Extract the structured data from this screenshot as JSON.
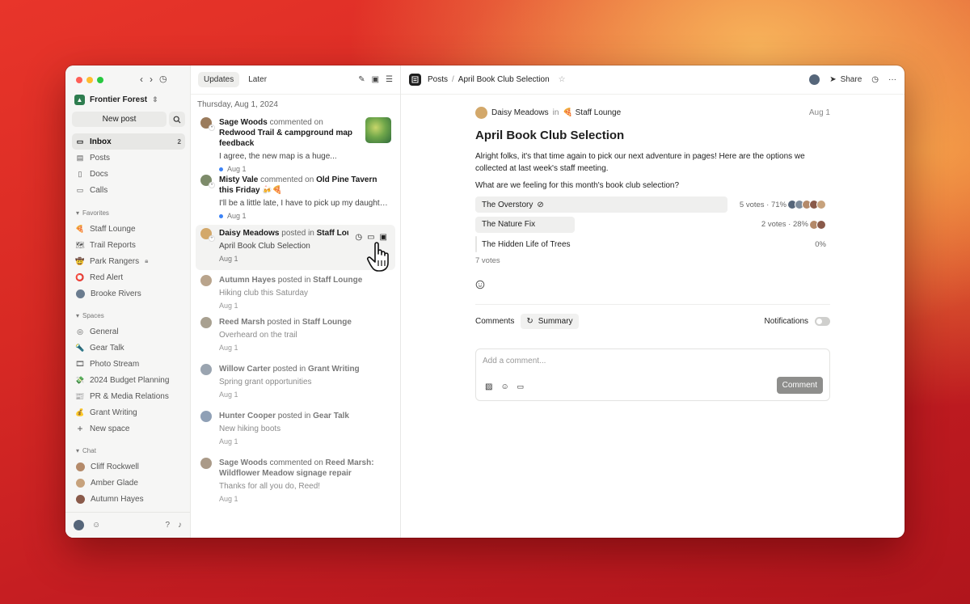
{
  "colors": {
    "red": "#ff5f57",
    "yellow": "#febc2e",
    "green": "#28c840",
    "accent_blue": "#3b82f6"
  },
  "workspace": {
    "name": "Frontier Forest"
  },
  "sidebar": {
    "new_post": "New post",
    "nav": [
      {
        "label": "Inbox",
        "count": "2",
        "icon": "inbox-icon"
      },
      {
        "label": "Posts",
        "icon": "posts-icon"
      },
      {
        "label": "Docs",
        "icon": "docs-icon"
      },
      {
        "label": "Calls",
        "icon": "video-icon"
      }
    ],
    "favorites_title": "Favorites",
    "favorites": [
      {
        "label": "Staff Lounge",
        "emoji": "🍕"
      },
      {
        "label": "Trail Reports",
        "emoji": "🗺"
      },
      {
        "label": "Park Rangers",
        "emoji": "🤠"
      },
      {
        "label": "Red Alert",
        "emoji": "⭕"
      },
      {
        "label": "Brooke Rivers",
        "emoji": ""
      }
    ],
    "spaces_title": "Spaces",
    "spaces": [
      {
        "label": "General",
        "emoji": "◎"
      },
      {
        "label": "Gear Talk",
        "emoji": "🔦"
      },
      {
        "label": "Photo Stream",
        "emoji": "🎞"
      },
      {
        "label": "2024 Budget Planning",
        "emoji": "💸"
      },
      {
        "label": "PR & Media Relations",
        "emoji": "📰"
      },
      {
        "label": "Grant Writing",
        "emoji": "💰"
      },
      {
        "label": "New space",
        "emoji": "+"
      }
    ],
    "chat_title": "Chat",
    "chats": [
      {
        "label": "Cliff Rockwell"
      },
      {
        "label": "Amber Glade"
      },
      {
        "label": "Autumn Hayes"
      }
    ]
  },
  "middle": {
    "tabs": [
      "Updates",
      "Later"
    ],
    "date_header": "Thursday, Aug 1, 2024",
    "items": [
      {
        "author": "Sage Woods",
        "verb": "commented on",
        "target": "Redwood Trail & campground map feedback",
        "snippet": "I agree, the new map is a huge...",
        "date": "Aug 1",
        "unread": true
      },
      {
        "author": "Misty Vale",
        "verb": "commented on",
        "target": "Old Pine Tavern this Friday 🍻🍕",
        "snippet": "I'll be a little late, I have to pick up my daughter...",
        "date": "Aug 1",
        "unread": true
      },
      {
        "author": "Daisy Meadows",
        "verb": "posted in",
        "target": "Staff Lounge",
        "snippet": "April Book Club Selection",
        "date": "Aug 1"
      },
      {
        "author": "Autumn Hayes",
        "verb": "posted in",
        "target": "Staff Lounge",
        "snippet": "Hiking club this Saturday",
        "date": "Aug 1"
      },
      {
        "author": "Reed Marsh",
        "verb": "posted in",
        "target": "Staff Lounge",
        "snippet": "Overheard on the trail",
        "date": "Aug 1"
      },
      {
        "author": "Willow Carter",
        "verb": "posted in",
        "target": "Grant Writing",
        "snippet": "Spring grant opportunities",
        "date": "Aug 1"
      },
      {
        "author": "Hunter Cooper",
        "verb": "posted in",
        "target": "Gear Talk",
        "snippet": "New hiking boots",
        "date": "Aug 1"
      },
      {
        "author": "Sage Woods",
        "verb": "commented on",
        "target": "Reed Marsh: Wildflower Meadow signage repair",
        "snippet": "Thanks for all you do, Reed!",
        "date": "Aug 1"
      }
    ]
  },
  "header": {
    "section": "Posts",
    "title": "April Book Club Selection",
    "share": "Share"
  },
  "post": {
    "author": "Daisy Meadows",
    "in": "in",
    "channel": "🍕 Staff Lounge",
    "date": "Aug 1",
    "title": "April Book Club Selection",
    "body": "Alright folks, it's that time again to pick our next adventure in pages! Here are the options we collected at last week's staff meeting.",
    "question": "What are we feeling for this month's book club selection?",
    "poll": [
      {
        "label": "The Overstory",
        "stats": "5 votes · 71%",
        "fraction": 0.71,
        "checked": true
      },
      {
        "label": "The Nature Fix",
        "stats": "2 votes · 28%",
        "fraction": 0.28,
        "checked": false
      },
      {
        "label": "The Hidden Life of Trees",
        "stats": "0%",
        "fraction": 0.0,
        "checked": false
      }
    ],
    "total_votes": "7 votes"
  },
  "comments": {
    "tab": "Comments",
    "summary": "Summary",
    "notifications": "Notifications",
    "placeholder": "Add a comment...",
    "submit": "Comment"
  }
}
